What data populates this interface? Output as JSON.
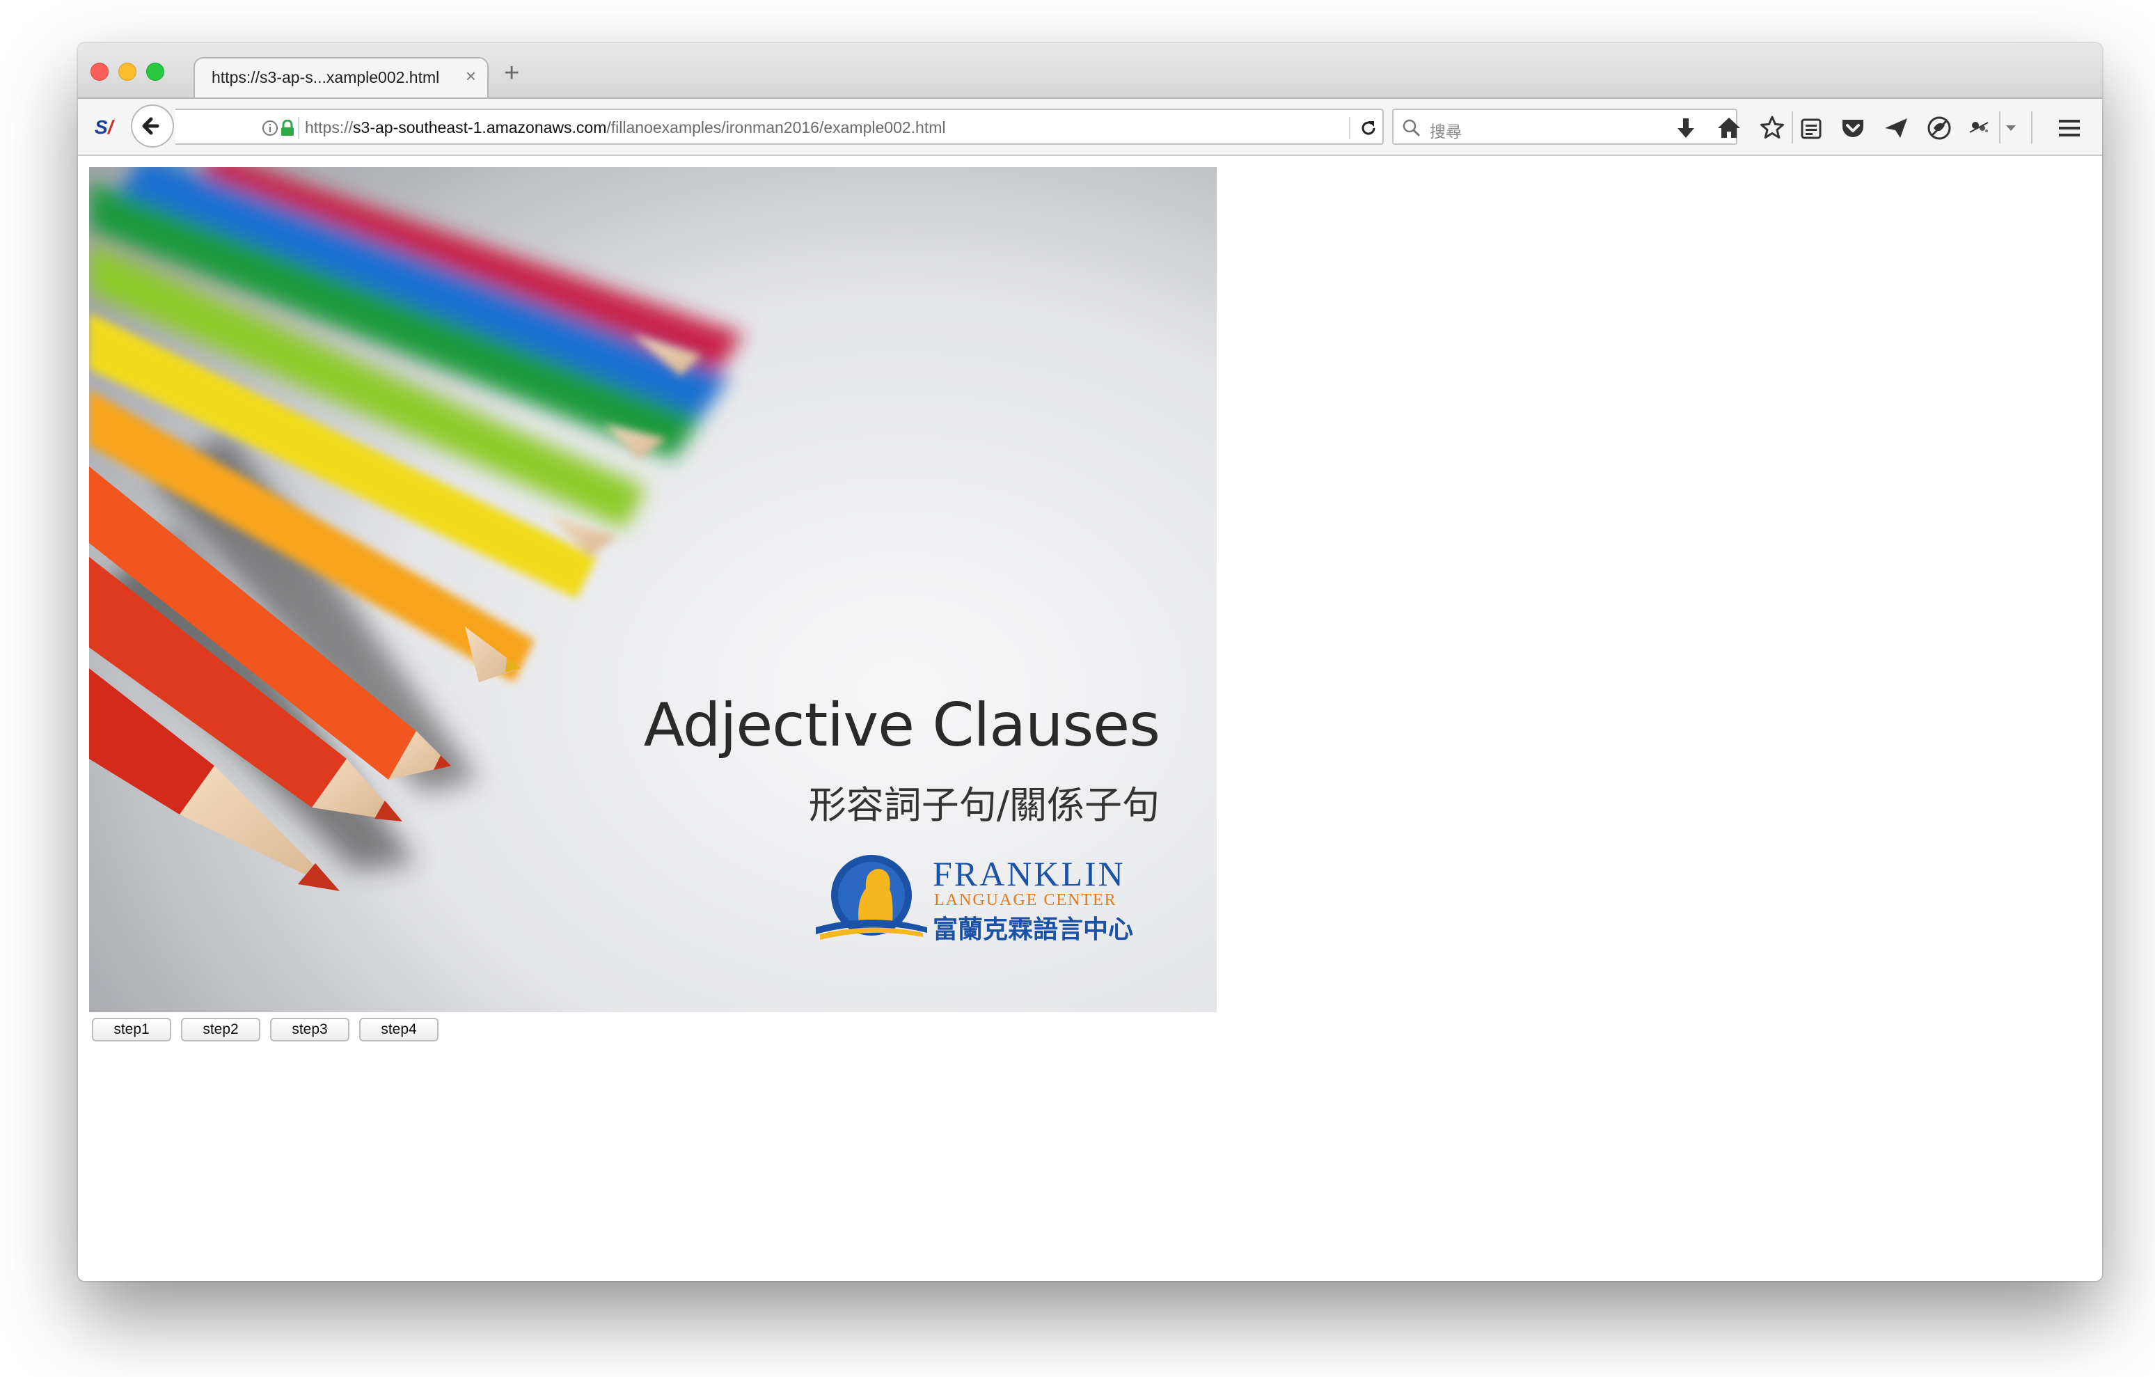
{
  "window": {
    "controls": [
      "close",
      "minimize",
      "zoom"
    ]
  },
  "tabs": [
    {
      "title": "https://s3-ap-s...xample002.html",
      "close_glyph": "×"
    }
  ],
  "new_tab_glyph": "+",
  "navbar": {
    "extension_logo": {
      "text_a": "S",
      "text_b": "/"
    },
    "url": {
      "scheme": "https://",
      "host": "s3-ap-southeast-1.amazonaws.com",
      "path": "/fillanoexamples/ironman2016/example002.html"
    },
    "search": {
      "placeholder": "搜尋"
    },
    "toolbar_icons": [
      "download-icon",
      "home-icon",
      "bookmark-star-icon",
      "reading-list-icon",
      "pocket-icon",
      "send-icon",
      "tracking-protection-icon",
      "extension-icon",
      "overflow-chevron-icon",
      "hamburger-menu-icon"
    ]
  },
  "slide": {
    "title": "Adjective Clauses",
    "subtitle": "形容詞子句/關係子句",
    "brand": {
      "name": "FRANKLIN",
      "sub": "LANGUAGE CENTER",
      "cn": "富蘭克霖語言中心"
    },
    "pencil_colors": [
      "#d42a1c",
      "#f0561d",
      "#f6a41f",
      "#f1dc1e",
      "#8fcb2c",
      "#1f9a3c",
      "#1a6fd0",
      "#2a2f9a",
      "#d42a4c"
    ]
  },
  "steps": [
    {
      "label": "step1"
    },
    {
      "label": "step2"
    },
    {
      "label": "step3"
    },
    {
      "label": "step4"
    }
  ],
  "colors": {
    "brand_blue": "#1c52a6",
    "brand_orange": "#e47a17",
    "traffic_red": "#fc5f57",
    "traffic_yellow": "#fdbc2e",
    "traffic_green": "#29c840"
  }
}
